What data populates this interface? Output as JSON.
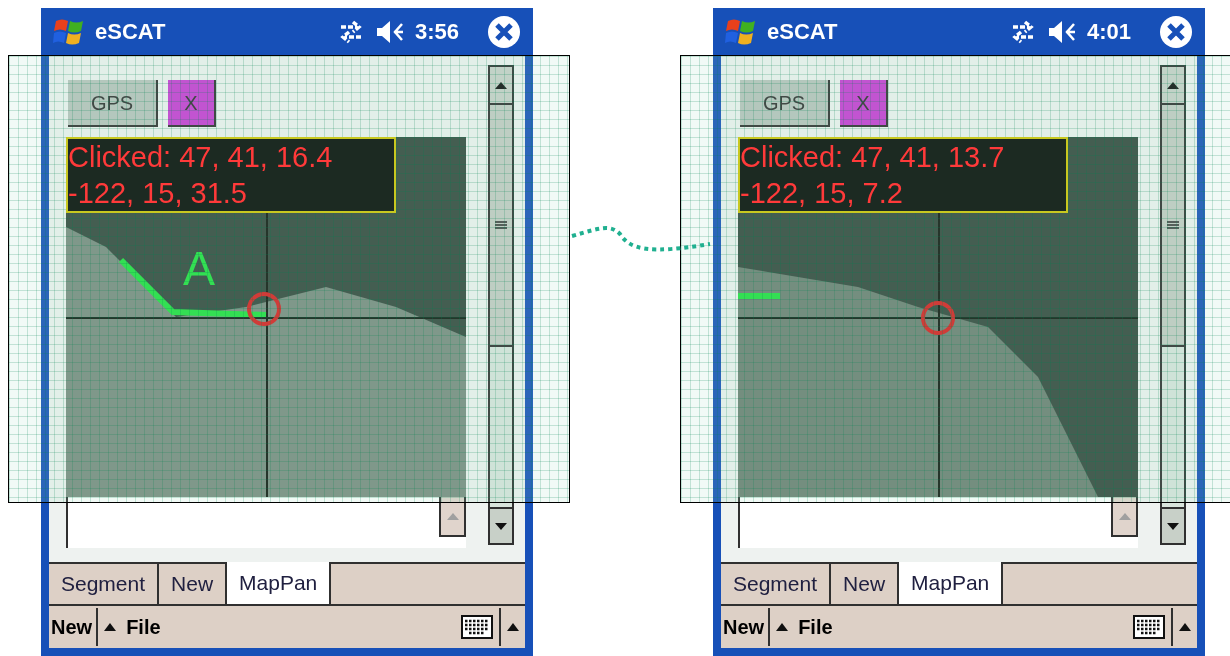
{
  "screens": [
    {
      "title": "eSCAT",
      "time": "3:56",
      "buttons": [
        "GPS",
        "X"
      ],
      "readout": [
        "Clicked: 47, 41, 16.4",
        "-122, 15, 31.5"
      ],
      "route_label": "A",
      "tabs": [
        {
          "label": "Segment",
          "selected": false
        },
        {
          "label": "New",
          "selected": false
        },
        {
          "label": "MapPan",
          "selected": true
        }
      ],
      "menu": [
        "New",
        "File"
      ]
    },
    {
      "title": "eSCAT",
      "time": "4:01",
      "buttons": [
        "GPS",
        "X"
      ],
      "readout": [
        "Clicked: 47, 41, 13.7",
        "-122, 15, 7.2"
      ],
      "tabs": [
        {
          "label": "Segment",
          "selected": false
        },
        {
          "label": "New",
          "selected": false
        },
        {
          "label": "MapPan",
          "selected": true
        }
      ],
      "menu": [
        "New",
        "File"
      ]
    }
  ]
}
